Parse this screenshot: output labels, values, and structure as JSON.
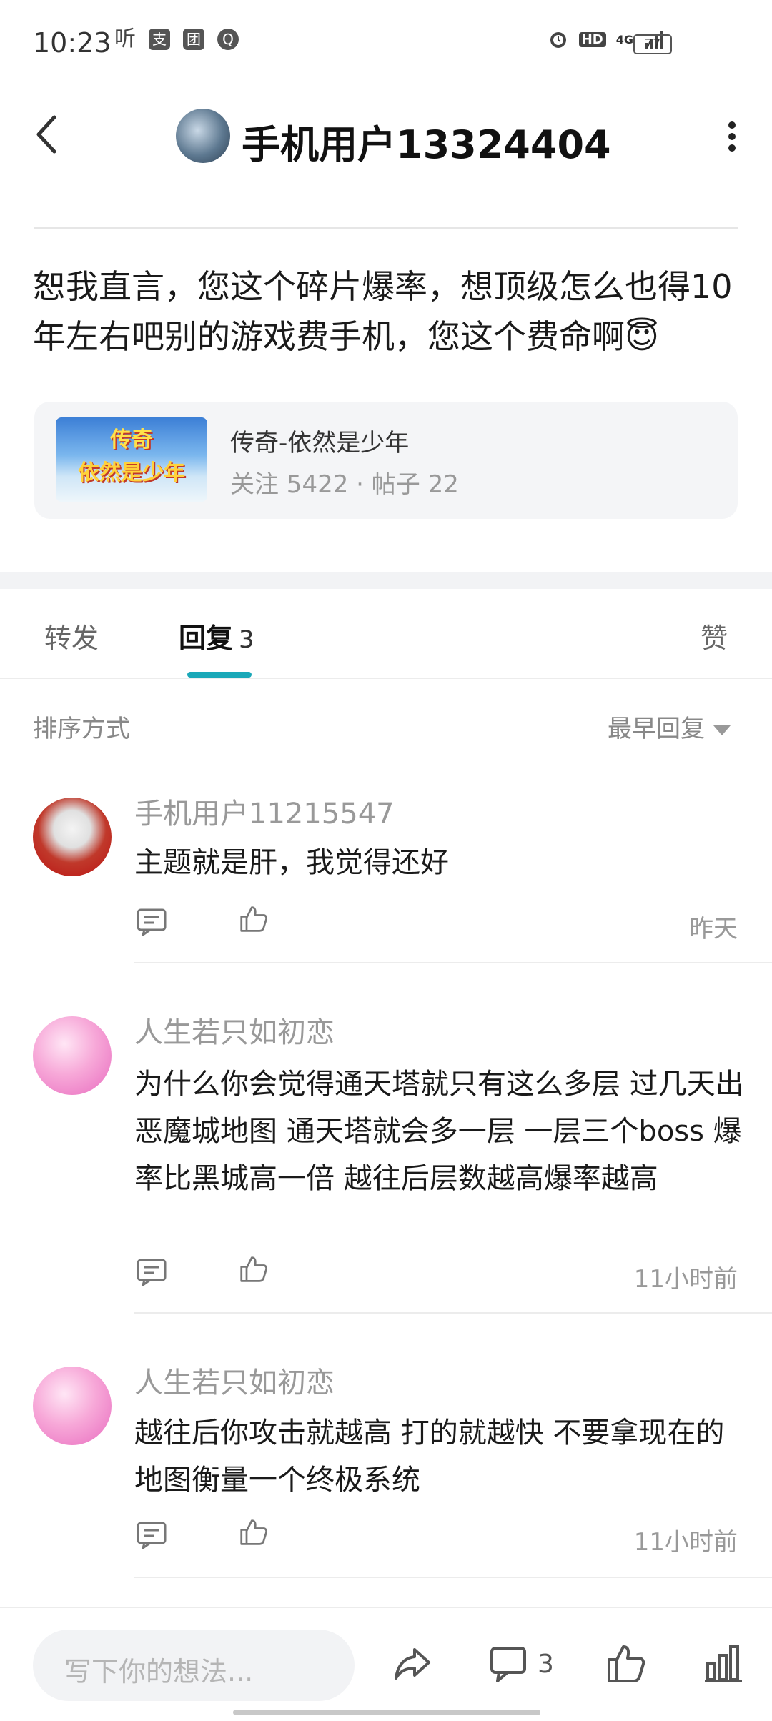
{
  "status_bar": {
    "time": "10:23",
    "left_icons": [
      "听",
      "支",
      "团",
      "Q"
    ],
    "right_icons": [
      "alarm-icon",
      "hd-icon",
      "4g-signal-icon"
    ],
    "network": "4G",
    "battery": "77"
  },
  "header": {
    "title": "手机用户13324404"
  },
  "post": {
    "text": "恕我直言，您这个碎片爆率，想顶级怎么也得10年左右吧别的游戏费手机，您这个费命啊😇"
  },
  "forum": {
    "image_line1": "传奇",
    "image_line2": "依然是少年",
    "name": "传奇-依然是少年",
    "stats": "关注  5422  ·  帖子  22"
  },
  "tabs": {
    "forward": "转发",
    "reply": "回复",
    "reply_count": "3",
    "like": "赞"
  },
  "sort": {
    "label": "排序方式",
    "value": "最早回复"
  },
  "comments": [
    {
      "user": "手机用户11215547",
      "text": "主题就是肝，我觉得还好",
      "time": "昨天"
    },
    {
      "user": "人生若只如初恋",
      "text": "为什么你会觉得通天塔就只有这么多层  过几天出恶魔城地图  通天塔就会多一层  一层三个boss  爆率比黑城高一倍  越往后层数越高爆率越高",
      "time": "11小时前"
    },
    {
      "user": "人生若只如初恋",
      "text": "越往后你攻击就越高  打的就越快  不要拿现在的地图衡量一个终极系统",
      "time": "11小时前"
    }
  ],
  "bottom_bar": {
    "input_placeholder": "写下你的想法...",
    "comment_count": "3"
  },
  "colors": {
    "accent": "#1aa8b8",
    "muted_text": "#999999",
    "background": "#ffffff"
  }
}
